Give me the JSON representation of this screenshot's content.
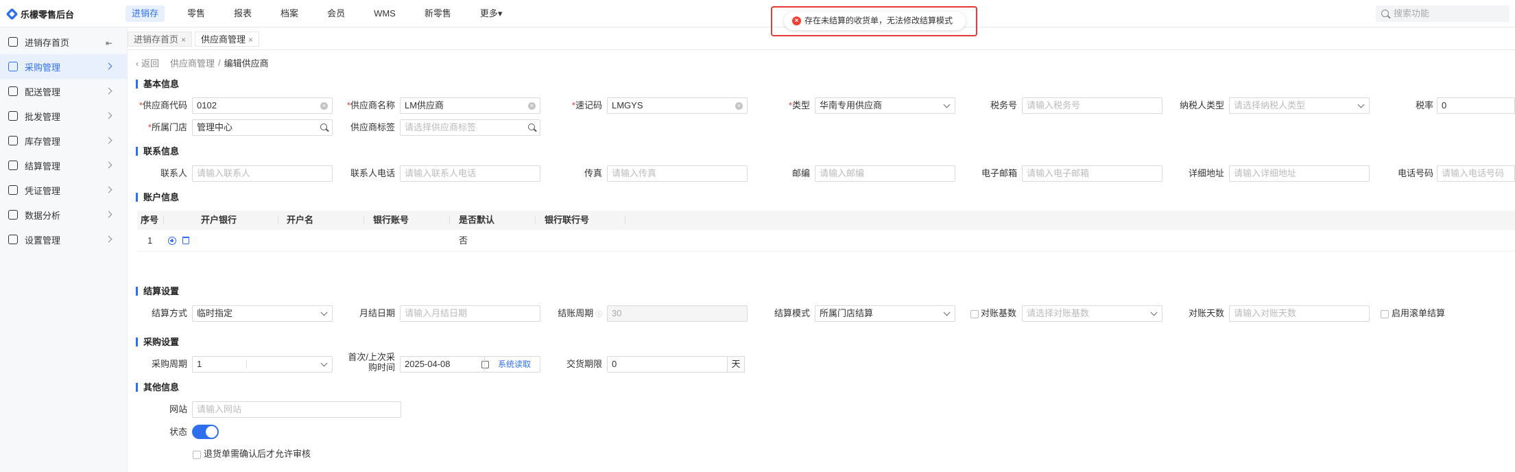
{
  "brand": {
    "logo_text": "乐檬零售后台"
  },
  "topnav": {
    "items": [
      "进销存",
      "零售",
      "报表",
      "档案",
      "会员",
      "WMS",
      "新零售",
      "更多▾"
    ],
    "active": "进销存",
    "search_placeholder": "搜索功能"
  },
  "toast": {
    "message": "存在未结算的收货单，无法修改结算模式",
    "color": "#e53935"
  },
  "sidebar": {
    "items": [
      {
        "label": "进销存首页",
        "icon": "home-icon"
      },
      {
        "label": "采购管理",
        "icon": "cart-icon"
      },
      {
        "label": "配送管理",
        "icon": "delivery-icon"
      },
      {
        "label": "批发管理",
        "icon": "wholesale-icon"
      },
      {
        "label": "库存管理",
        "icon": "inventory-icon"
      },
      {
        "label": "结算管理",
        "icon": "settlement-icon"
      },
      {
        "label": "凭证管理",
        "icon": "voucher-icon"
      },
      {
        "label": "数据分析",
        "icon": "analytics-icon"
      },
      {
        "label": "设置管理",
        "icon": "settings-icon"
      }
    ],
    "active": "采购管理",
    "collapse_glyph": "⇤"
  },
  "tabs": [
    {
      "label": "进销存首页",
      "close": "×"
    },
    {
      "label": "供应商管理",
      "close": "×"
    }
  ],
  "breadcrumb": {
    "back": "返回",
    "parent": "供应商管理",
    "sep": "/",
    "current": "编辑供应商"
  },
  "basic": {
    "title": "基本信息",
    "code": {
      "label": "供应商代码",
      "value": "0102"
    },
    "name": {
      "label": "供应商名称",
      "value": "LM供应商"
    },
    "mnemonic": {
      "label": "速记码",
      "value": "LMGYS"
    },
    "type": {
      "label": "类型",
      "value": "华南专用供应商"
    },
    "tax_no": {
      "label": "税务号",
      "placeholder": "请输入税务号"
    },
    "taxpayer": {
      "label": "纳税人类型",
      "placeholder": "请选择纳税人类型"
    },
    "tax_rate": {
      "label": "税率",
      "value": "0"
    },
    "store": {
      "label": "所属门店",
      "value": "管理中心"
    },
    "tags": {
      "label": "供应商标签",
      "placeholder": "请选择供应商标签"
    }
  },
  "contact": {
    "title": "联系信息",
    "fields": [
      {
        "label": "联系人",
        "placeholder": "请输入联系人"
      },
      {
        "label": "联系人电话",
        "placeholder": "请输入联系人电话"
      },
      {
        "label": "传真",
        "placeholder": "请输入传真"
      },
      {
        "label": "邮编",
        "placeholder": "请输入邮编"
      },
      {
        "label": "电子邮箱",
        "placeholder": "请输入电子邮箱"
      },
      {
        "label": "详细地址",
        "placeholder": "请输入详细地址"
      },
      {
        "label": "电话号码",
        "placeholder": "请输入电话号码"
      }
    ]
  },
  "account": {
    "title": "账户信息",
    "columns": [
      "序号",
      "开户银行",
      "开户名",
      "银行账号",
      "是否默认",
      "银行联行号"
    ],
    "rows": [
      {
        "index": "1",
        "is_default": "否"
      }
    ]
  },
  "settlement": {
    "title": "结算设置",
    "method": {
      "label": "结算方式",
      "value": "临时指定"
    },
    "month_day": {
      "label": "月结日期",
      "placeholder": "请输入月结日期"
    },
    "cycle": {
      "label": "结账周期",
      "value": "30"
    },
    "mode": {
      "label": "结算模式",
      "value": "所属门店结算"
    },
    "base": {
      "label": "对账基数",
      "placeholder": "请选择对账基数"
    },
    "days": {
      "label": "对账天数",
      "placeholder": "请输入对账天数"
    },
    "rolling": {
      "label": "启用滚单结算"
    }
  },
  "purchase": {
    "title": "采购设置",
    "period": {
      "label": "采购周期",
      "value": "1"
    },
    "first_time": {
      "label_line1": "首次/上次采",
      "label_line2": "购时间",
      "value": "2025-04-08",
      "link": "系统读取"
    },
    "lead": {
      "label": "交货期限",
      "value": "0",
      "unit": "天"
    }
  },
  "other": {
    "title": "其他信息",
    "website": {
      "label": "网站",
      "placeholder": "请输入网站"
    },
    "status": {
      "label": "状态",
      "on": true
    },
    "return_check": {
      "label": "退货单需确认后才允许审核"
    }
  }
}
